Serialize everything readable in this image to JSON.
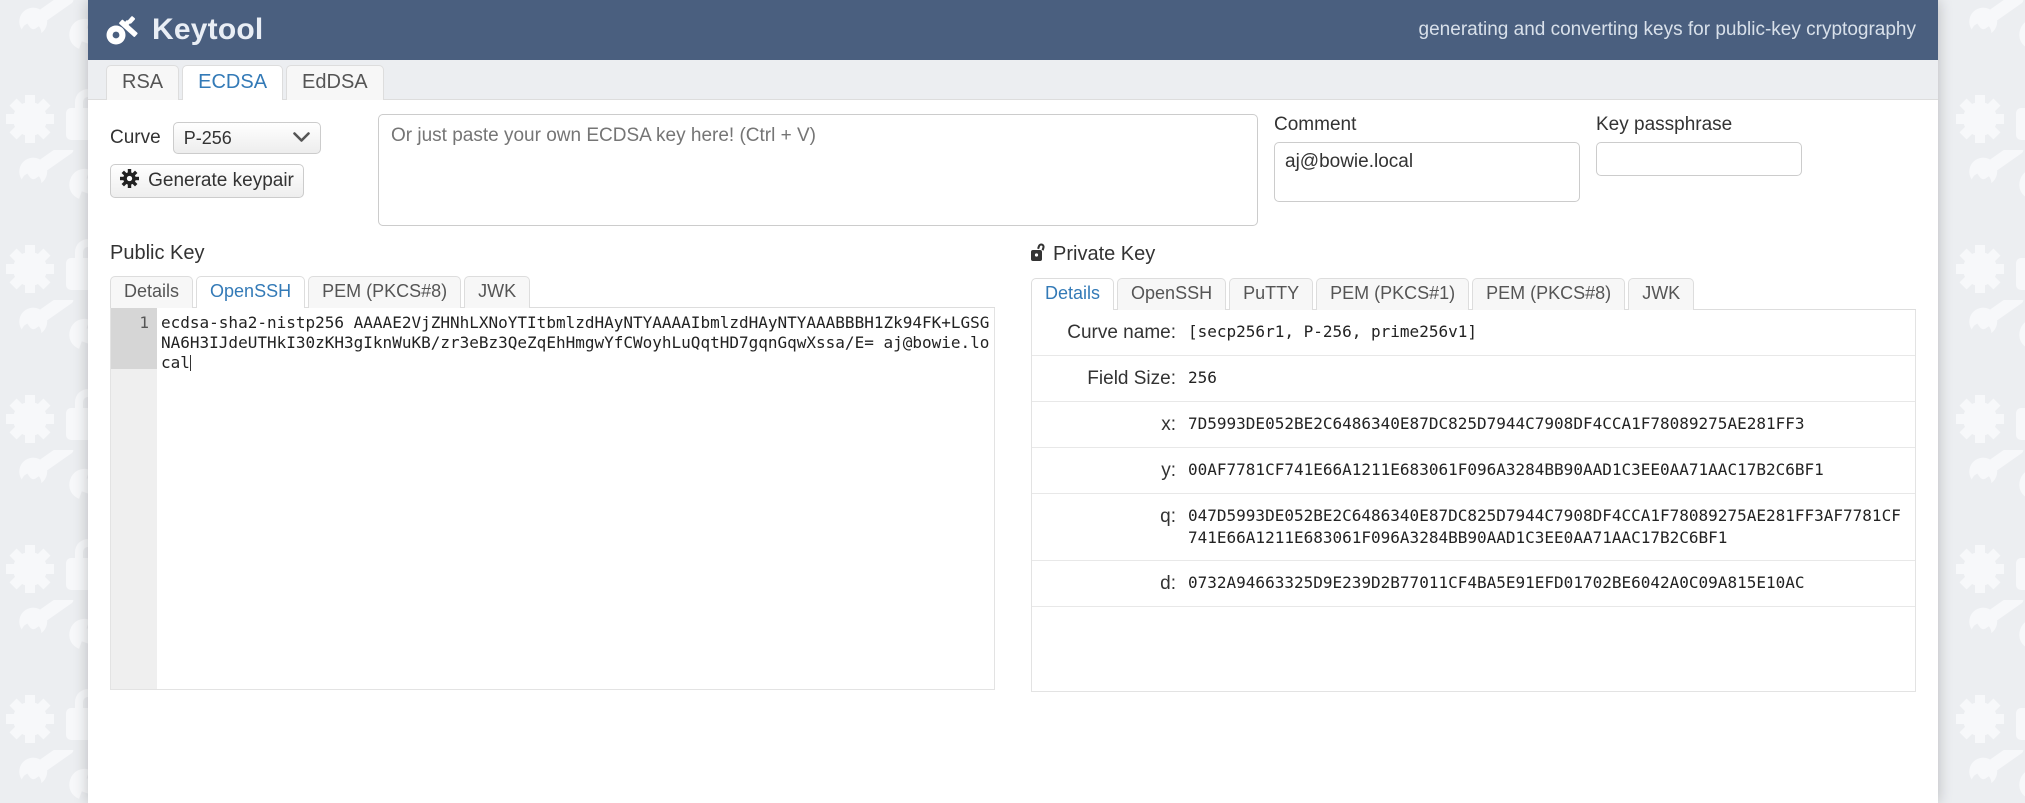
{
  "header": {
    "title": "Keytool",
    "tagline": "generating and converting keys for public-key cryptography",
    "logo_icon": "key-icon",
    "bg_color": "#4a5f7f"
  },
  "main_tabs": [
    {
      "label": "RSA",
      "active": false
    },
    {
      "label": "ECDSA",
      "active": true
    },
    {
      "label": "EdDSA",
      "active": false
    }
  ],
  "controls": {
    "curve_label": "Curve",
    "curve_value": "P-256",
    "curve_options": [
      "P-256"
    ],
    "generate_label": "Generate keypair",
    "generate_icon": "gear-icon",
    "paste_placeholder": "Or just paste your own ECDSA key here! (Ctrl + V)",
    "paste_value": "",
    "comment_label": "Comment",
    "comment_value": "aj@bowie.local",
    "passphrase_label": "Key passphrase",
    "passphrase_value": ""
  },
  "public_key": {
    "title": "Public Key",
    "tabs": [
      {
        "label": "Details",
        "active": false
      },
      {
        "label": "OpenSSH",
        "active": true
      },
      {
        "label": "PEM (PKCS#8)",
        "active": false
      },
      {
        "label": "JWK",
        "active": false
      }
    ],
    "line_number": "1",
    "openssh": "ecdsa-sha2-nistp256 AAAAE2VjZHNhLXNoYTItbmlzdHAyNTYAAAAIbmlzdHAyNTYAAABBBH1Zk94FK+LGSGNA6H3IJdeUTHkI30zKH3gIknWuKB/zr3eBz3QeZqEhHmgwYfCWoyhLuQqtHD7gqnGqwXssa/E= aj@bowie.local"
  },
  "private_key": {
    "title": "Private Key",
    "title_icon": "unlock-icon",
    "tabs": [
      {
        "label": "Details",
        "active": true
      },
      {
        "label": "OpenSSH",
        "active": false
      },
      {
        "label": "PuTTY",
        "active": false
      },
      {
        "label": "PEM (PKCS#1)",
        "active": false
      },
      {
        "label": "PEM (PKCS#8)",
        "active": false
      },
      {
        "label": "JWK",
        "active": false
      }
    ],
    "details": [
      {
        "key": "Curve name:",
        "value": "[secp256r1, P-256, prime256v1]"
      },
      {
        "key": "Field Size:",
        "value": "256"
      },
      {
        "key": "x:",
        "value": "7D5993DE052BE2C6486340E87DC825D7944C7908DF4CCA1F78089275AE281FF3"
      },
      {
        "key": "y:",
        "value": "00AF7781CF741E66A1211E683061F096A3284BB90AAD1C3EE0AA71AAC17B2C6BF1"
      },
      {
        "key": "q:",
        "value": "047D5993DE052BE2C6486340E87DC825D7944C7908DF4CCA1F78089275AE281FF3AF7781CF741E66A1211E683061F096A3284BB90AAD1C3EE0AA71AAC17B2C6BF1"
      },
      {
        "key": "d:",
        "value": "0732A94663325D9E239D2B77011CF4BA5E91EFD01702BE6042A0C09A815E10AC"
      }
    ]
  },
  "colors": {
    "accent": "#337ab7",
    "header": "#4a5f7f",
    "page_bg": "#eceef1"
  }
}
